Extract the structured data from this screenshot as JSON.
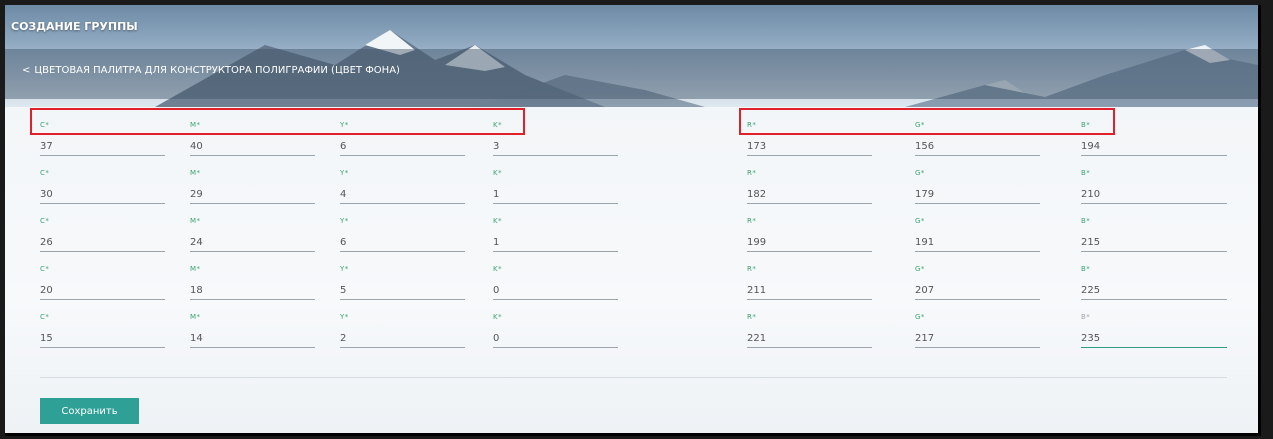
{
  "header": {
    "title": "СОЗДАНИЕ ГРУППЫ",
    "back_chevron": "<",
    "subtitle": "ЦВЕТОВАЯ ПАЛИТРА ДЛЯ КОНСТРУКТОРА ПОЛИГРАФИИ (ЦВЕТ ФОНА)"
  },
  "labels": {
    "c": "C*",
    "m": "M*",
    "y": "Y*",
    "k": "K*",
    "r": "R*",
    "g": "G*",
    "b": "B*"
  },
  "rows": [
    {
      "c": "37",
      "m": "40",
      "y": "6",
      "k": "3",
      "r": "173",
      "g": "156",
      "b": "194"
    },
    {
      "c": "30",
      "m": "29",
      "y": "4",
      "k": "1",
      "r": "182",
      "g": "179",
      "b": "210"
    },
    {
      "c": "26",
      "m": "24",
      "y": "6",
      "k": "1",
      "r": "199",
      "g": "191",
      "b": "215"
    },
    {
      "c": "20",
      "m": "18",
      "y": "5",
      "k": "0",
      "r": "211",
      "g": "207",
      "b": "225"
    },
    {
      "c": "15",
      "m": "14",
      "y": "2",
      "k": "0",
      "r": "221",
      "g": "217",
      "b": "235"
    }
  ],
  "focused_field": "rows.4.b",
  "save_button": "Сохранить",
  "colors": {
    "accent": "#2ea096",
    "label_green": "#3aa572",
    "highlight_red": "#e0202a"
  }
}
